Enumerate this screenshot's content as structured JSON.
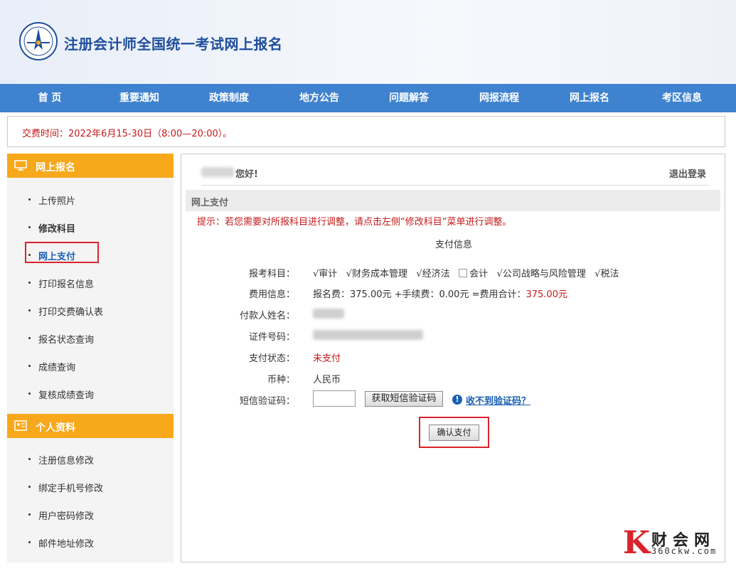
{
  "header": {
    "site_title": "注册会计师全国统一考试网上报名",
    "logo_icon": "cicpa-logo-icon"
  },
  "nav": [
    "首 页",
    "重要通知",
    "政策制度",
    "地方公告",
    "问题解答",
    "网报流程",
    "网上报名",
    "考区信息"
  ],
  "notice": "交费时间：2022年6月15-30日（8:00—20:00）。",
  "sidebar": {
    "section1_title": "网上报名",
    "section1_items": [
      "上传照片",
      "修改科目",
      "网上支付",
      "打印报名信息",
      "打印交费确认表",
      "报名状态查询",
      "成绩查询",
      "复核成绩查询"
    ],
    "section2_title": "个人资料",
    "section2_items": [
      "注册信息修改",
      "绑定手机号修改",
      "用户密码修改",
      "邮件地址修改"
    ]
  },
  "main": {
    "greeting": "您好!",
    "logout": "退出登录",
    "section_title": "网上支付",
    "tip": "提示：若您需要对所报科目进行调整，请点击左侧“修改科目”菜单进行调整。",
    "pay_info_title": "支付信息",
    "labels": {
      "subjects": "报考科目：",
      "fee": "费用信息：",
      "payer": "付款人姓名：",
      "id_no": "证件号码：",
      "status": "支付状态：",
      "currency": "币种：",
      "sms": "短信验证码："
    },
    "subjects": {
      "checked": [
        "√审计",
        "√财务成本管理",
        "√经济法"
      ],
      "unchecked": "会计",
      "checked_after": [
        "√公司战略与风险管理",
        "√税法"
      ]
    },
    "fee": {
      "text": "报名费：375.00元 +手续费：0.00元 =费用合计：",
      "total": "375.00元"
    },
    "status_value": "未支付",
    "currency_value": "人民币",
    "sms_button": "获取短信验证码",
    "help_link": "收不到验证码？",
    "confirm_button": "确认支付"
  },
  "watermark": {
    "name": "财会网",
    "url": "360ckw.com",
    "mark": "K"
  }
}
